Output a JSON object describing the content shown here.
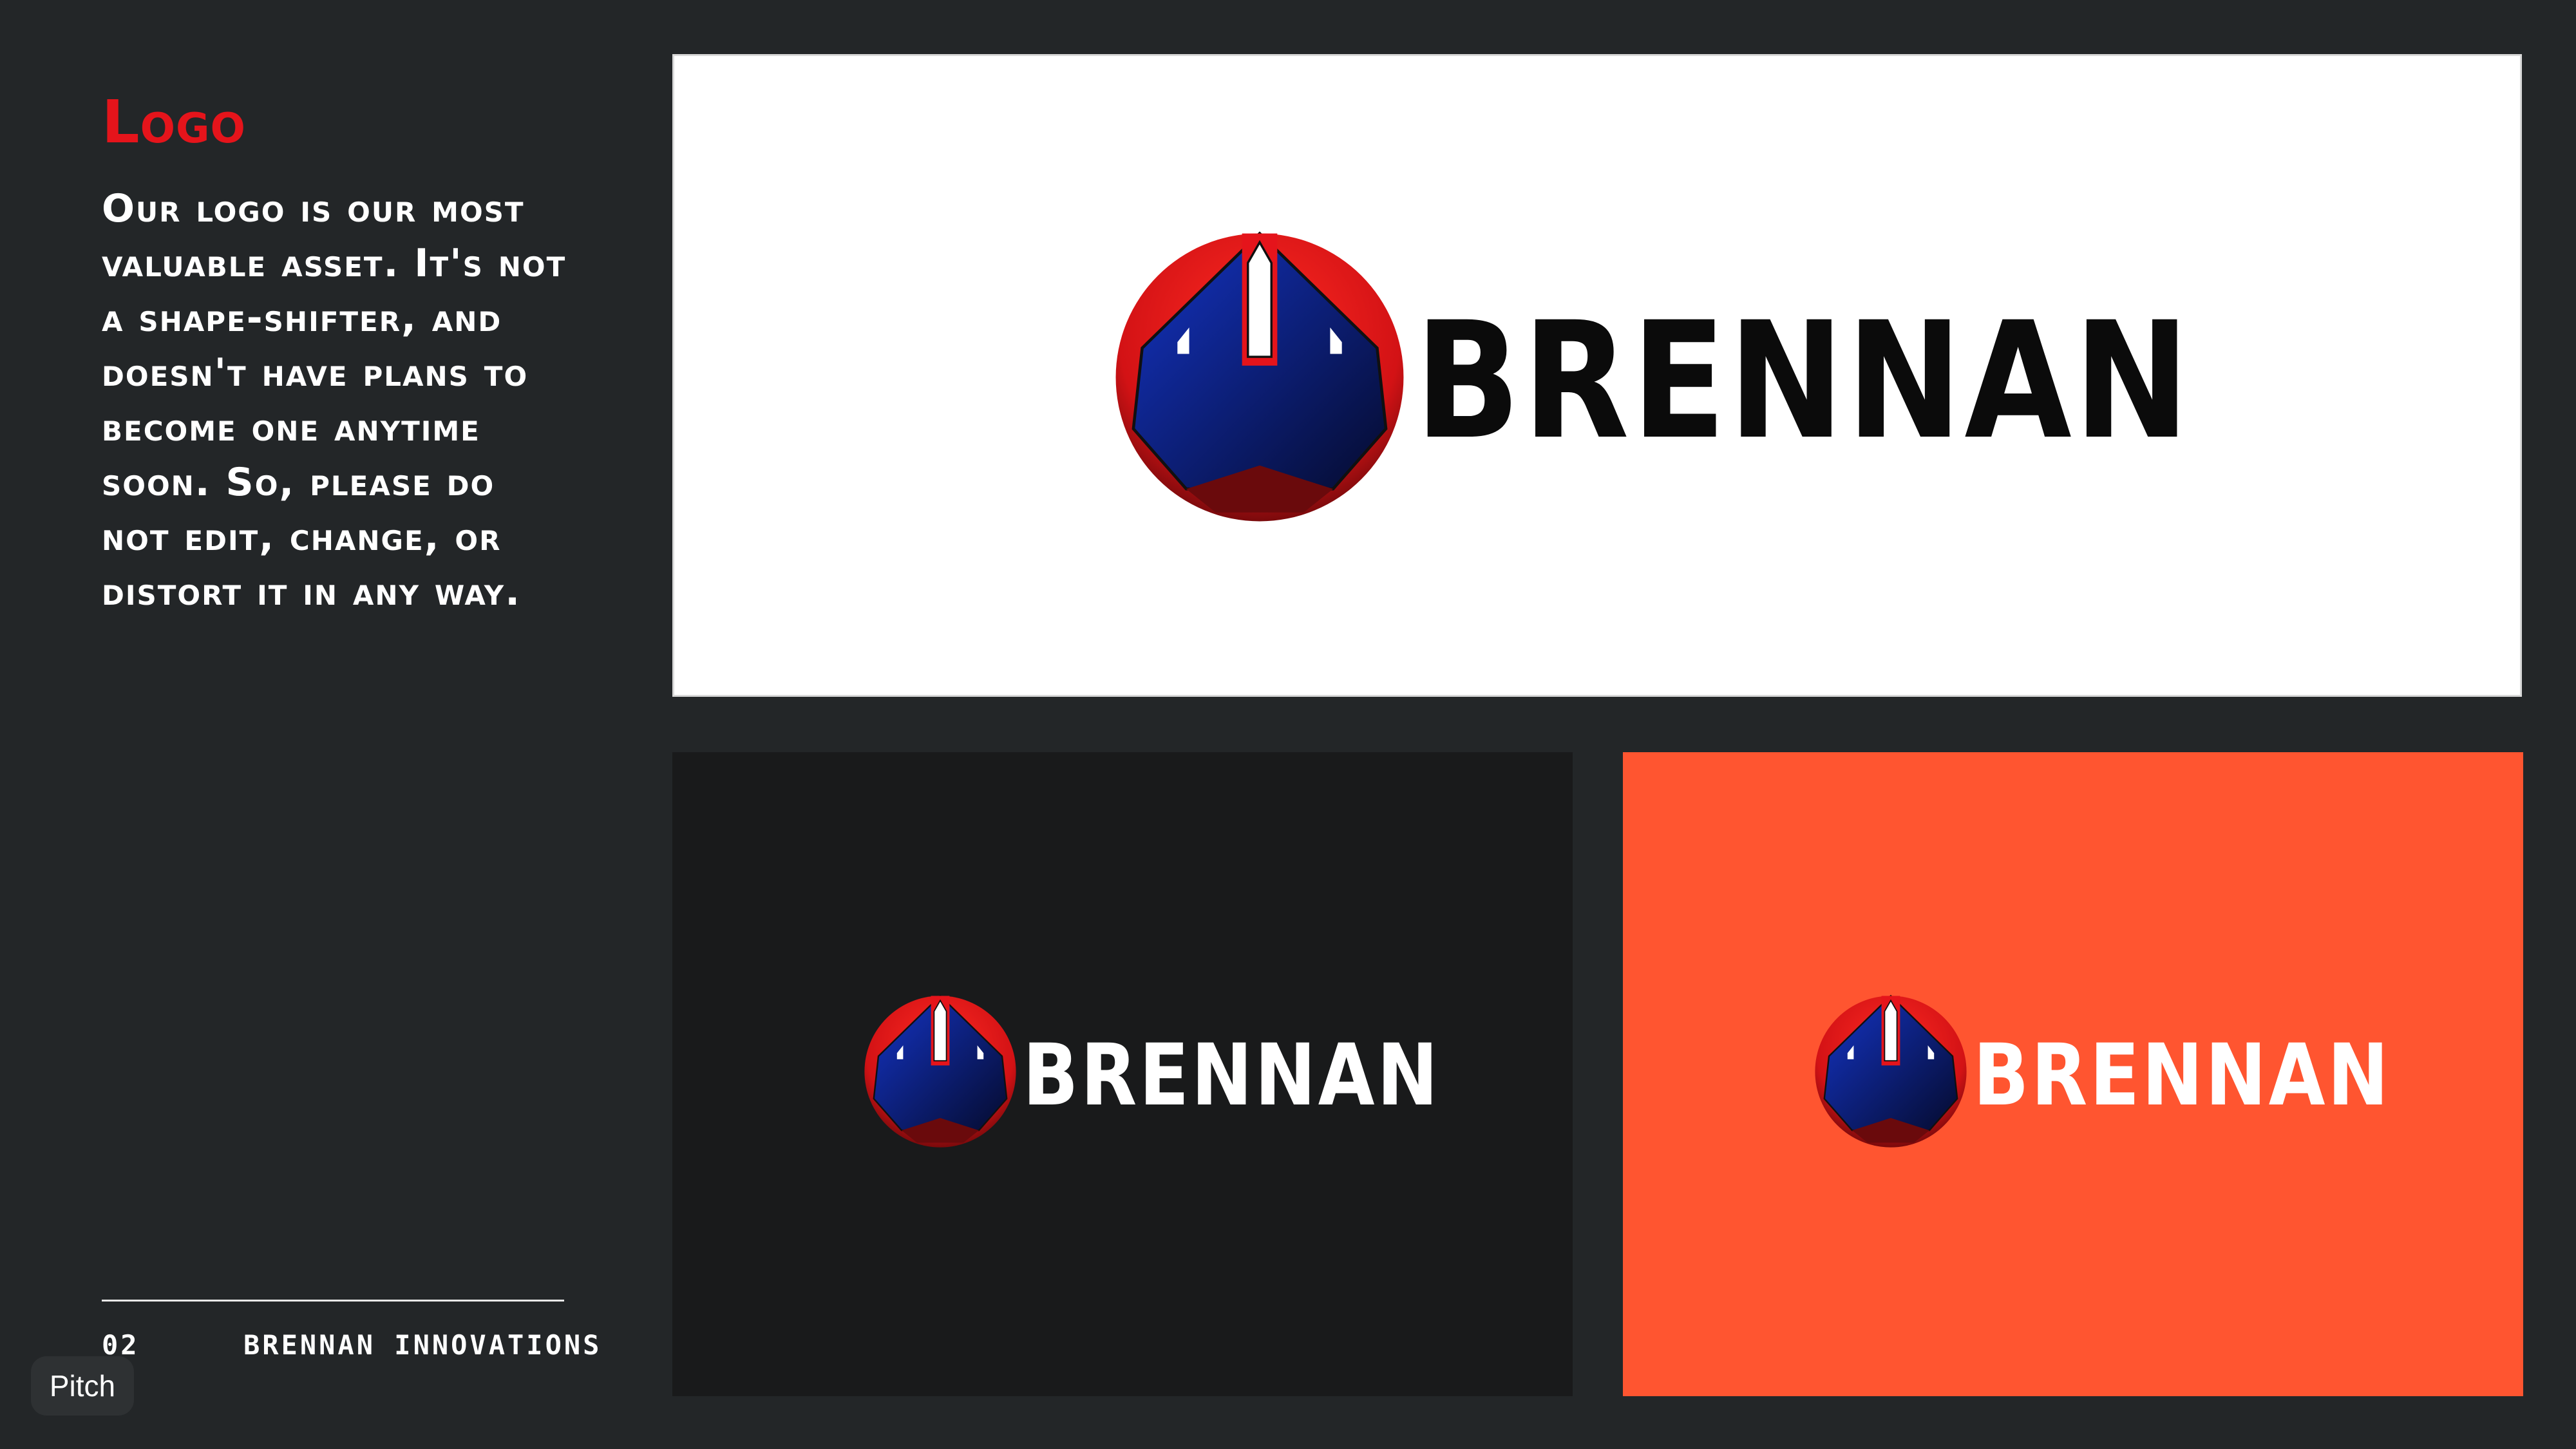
{
  "slide": {
    "title": "Logo",
    "body": "Our logo is our most valuable asset. It's not a shape-shifter, and doesn't have plans to become one anytime soon. So, please do not edit, change, or distort it in any way.",
    "page_number": "02",
    "company": "BRENNAN INNOVATIONS"
  },
  "logo": {
    "wordmark": "BRENNAN",
    "icon": "rocket-emblem-icon"
  },
  "panels": {
    "light": {
      "background": "#ffffff",
      "wordmark_color": "#0b0b0b"
    },
    "dark": {
      "background": "#191a1b",
      "wordmark_color": "#ffffff"
    },
    "orange": {
      "background": "#ff5530",
      "wordmark_color": "#ffffff"
    }
  },
  "colors": {
    "app_background": "#232628",
    "accent_red": "#e5141b",
    "emblem_red": "#d31215",
    "emblem_blue": "#0a1f8a"
  },
  "badge": {
    "label": "Pitch"
  }
}
